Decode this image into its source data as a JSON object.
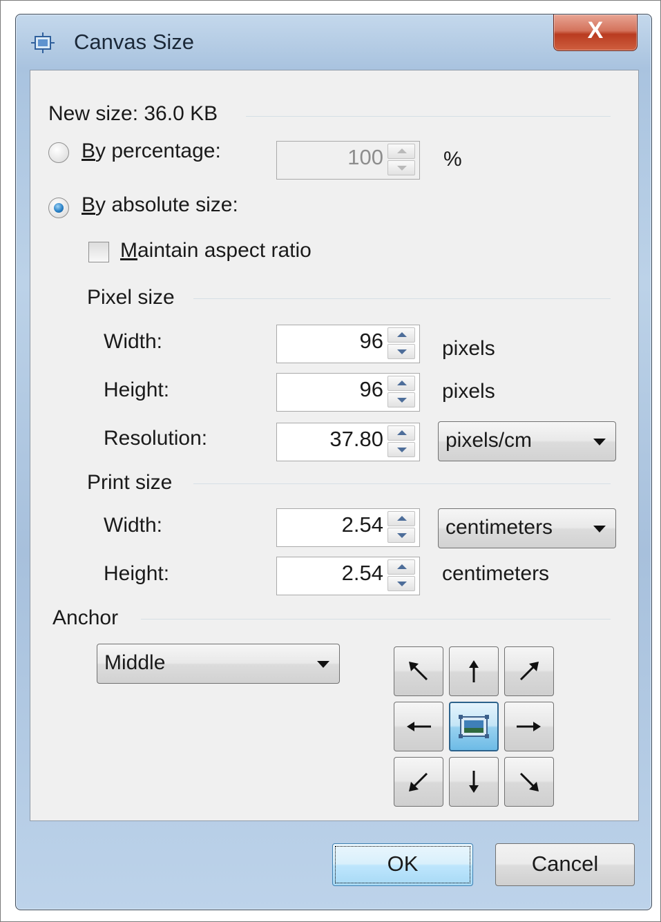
{
  "window": {
    "title": "Canvas Size",
    "close_label": "X",
    "icon": "canvas-size-icon"
  },
  "new_size": "New size: 36.0 KB",
  "by_percentage": {
    "label_mnemonic": "B",
    "label_rest": "y percentage:",
    "selected": false,
    "value": "100",
    "unit": "%"
  },
  "by_absolute": {
    "label_mnemonic": "B",
    "label_rest": "y absolute size:",
    "selected": true
  },
  "maintain_aspect": {
    "label_mnemonic": "M",
    "label_rest": "aintain aspect ratio",
    "checked": false
  },
  "pixel_size": {
    "heading": "Pixel size",
    "width_label": "Width:",
    "width_value": "96",
    "width_unit": "pixels",
    "height_label": "Height:",
    "height_value": "96",
    "height_unit": "pixels",
    "resolution_label": "Resolution:",
    "resolution_value": "37.80",
    "resolution_unit": "pixels/cm"
  },
  "print_size": {
    "heading": "Print size",
    "width_label": "Width:",
    "width_value": "2.54",
    "width_unit": "centimeters",
    "height_label": "Height:",
    "height_value": "2.54",
    "height_unit": "centimeters"
  },
  "anchor": {
    "heading": "Anchor",
    "selected": "Middle",
    "grid": [
      [
        "arrow-up-left-icon",
        "arrow-up-icon",
        "arrow-up-right-icon"
      ],
      [
        "arrow-left-icon",
        "anchor-center-icon",
        "arrow-right-icon"
      ],
      [
        "arrow-down-left-icon",
        "arrow-down-icon",
        "arrow-down-right-icon"
      ]
    ]
  },
  "buttons": {
    "ok": "OK",
    "cancel": "Cancel"
  },
  "colors": {
    "accent": "#2b83c8",
    "close": "#c6472b"
  }
}
